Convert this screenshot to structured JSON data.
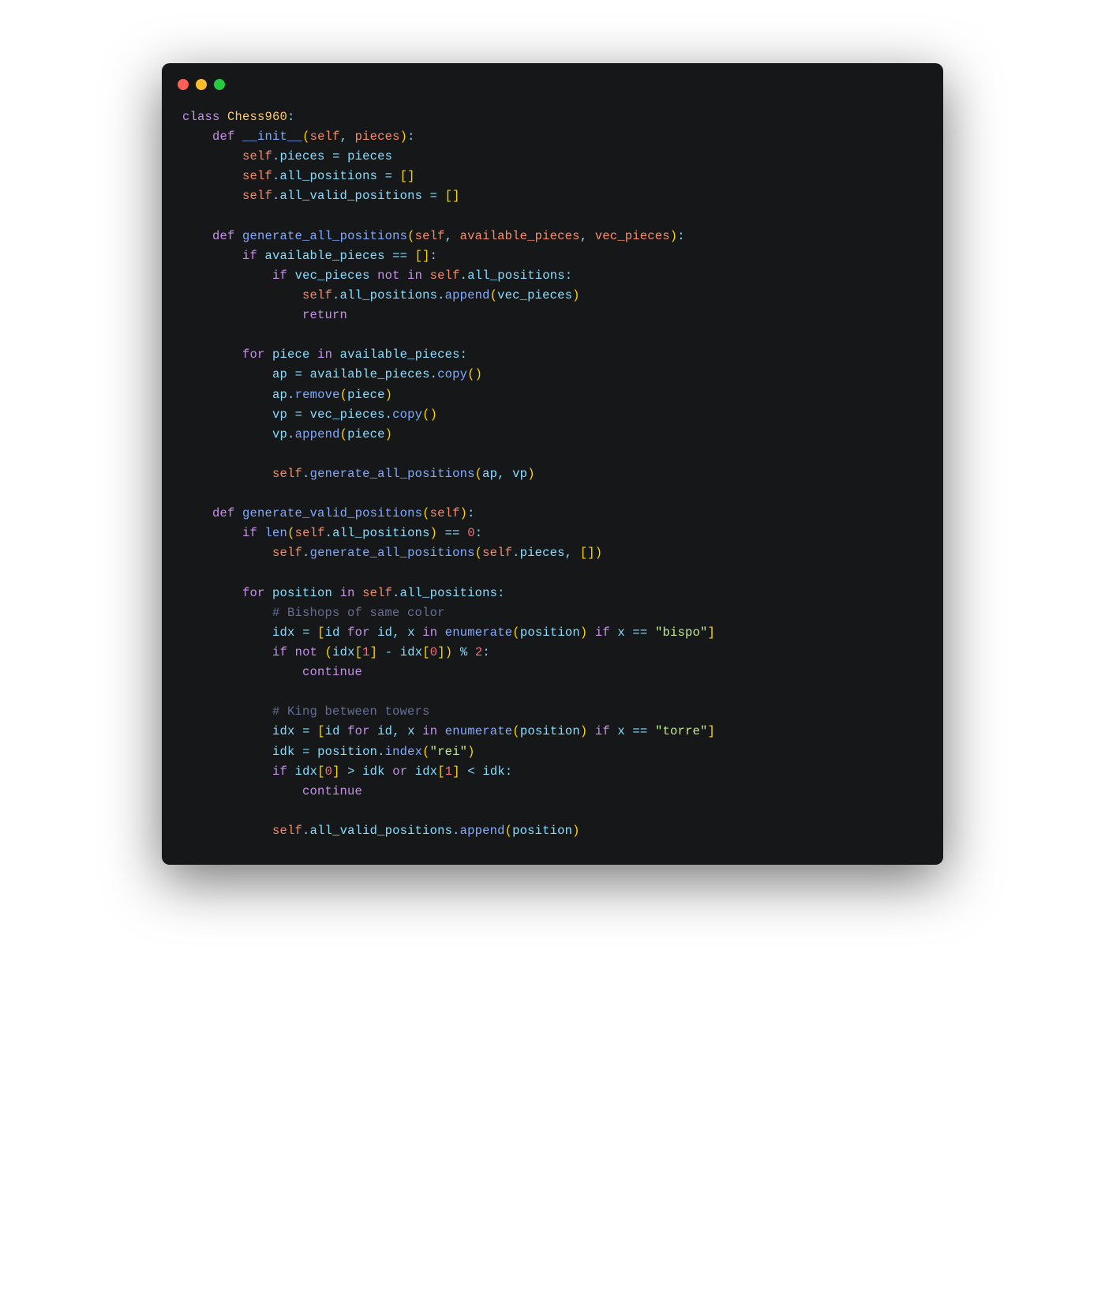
{
  "window": {
    "traffic_lights": [
      "red",
      "yellow",
      "green"
    ]
  },
  "code": {
    "class_name": "Chess960",
    "methods": {
      "init": "__init__",
      "gen_all": "generate_all_positions",
      "gen_valid": "generate_valid_positions"
    },
    "params": {
      "self": "self",
      "pieces": "pieces",
      "available_pieces": "available_pieces",
      "vec_pieces": "vec_pieces"
    },
    "attrs": {
      "pieces": "pieces",
      "all_positions": "all_positions",
      "all_valid_positions": "all_valid_positions"
    },
    "locals": {
      "piece": "piece",
      "ap": "ap",
      "vp": "vp",
      "position": "position",
      "idx": "idx",
      "id": "id",
      "x": "x",
      "idk": "idk"
    },
    "calls": {
      "append": "append",
      "copy": "copy",
      "remove": "remove",
      "len": "len",
      "enumerate": "enumerate",
      "index": "index"
    },
    "keywords": {
      "class": "class",
      "def": "def",
      "if": "if",
      "not": "not",
      "in": "in",
      "return": "return",
      "for": "for",
      "continue": "continue",
      "or": "or"
    },
    "literals": {
      "zero": "0",
      "one": "1",
      "two": "2",
      "bispo": "\"bispo\"",
      "torre": "\"torre\"",
      "rei": "\"rei\""
    },
    "comments": {
      "bishops": "# Bishops of same color",
      "king": "# King between towers"
    }
  }
}
